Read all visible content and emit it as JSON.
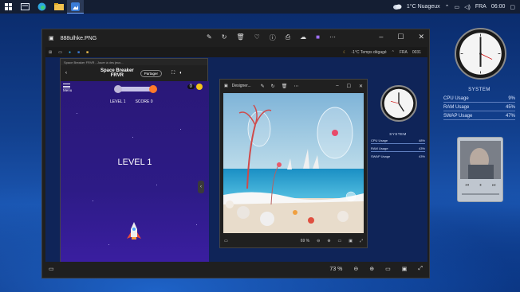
{
  "taskbar": {
    "weather": "1°C Nuageux",
    "language": "FRA",
    "time": "06:00"
  },
  "viewer": {
    "filename": "888ulhke.PNG",
    "zoom": "73 %"
  },
  "inner_taskbar": {
    "weather": "-1°C Temps dégagé",
    "language": "FRA",
    "time": "0031"
  },
  "game": {
    "window_title": "Space Breaker FRVR - Jouer à des jeux...",
    "title_line1": "Space Breaker",
    "title_line2": "FRVR",
    "share_label": "Partager",
    "menu_label": "Menu",
    "hud_level": "LEVEL 1",
    "hud_score": "SCORE 0",
    "coins": "0",
    "level_banner": "LEVEL 1"
  },
  "designer": {
    "title": "Designer...",
    "zoom": "69 %"
  },
  "inner_system": {
    "title": "SYSTEM",
    "rows": [
      {
        "label": "CPU Usage",
        "value": "48%"
      },
      {
        "label": "RAM Usage",
        "value": "43%"
      },
      {
        "label": "SWAP Usage",
        "value": "43%"
      }
    ]
  },
  "system": {
    "title": "SYSTEM",
    "rows": [
      {
        "label": "CPU Usage",
        "value": "9%"
      },
      {
        "label": "RAM Usage",
        "value": "45%"
      },
      {
        "label": "SWAP Usage",
        "value": "47%"
      }
    ]
  }
}
